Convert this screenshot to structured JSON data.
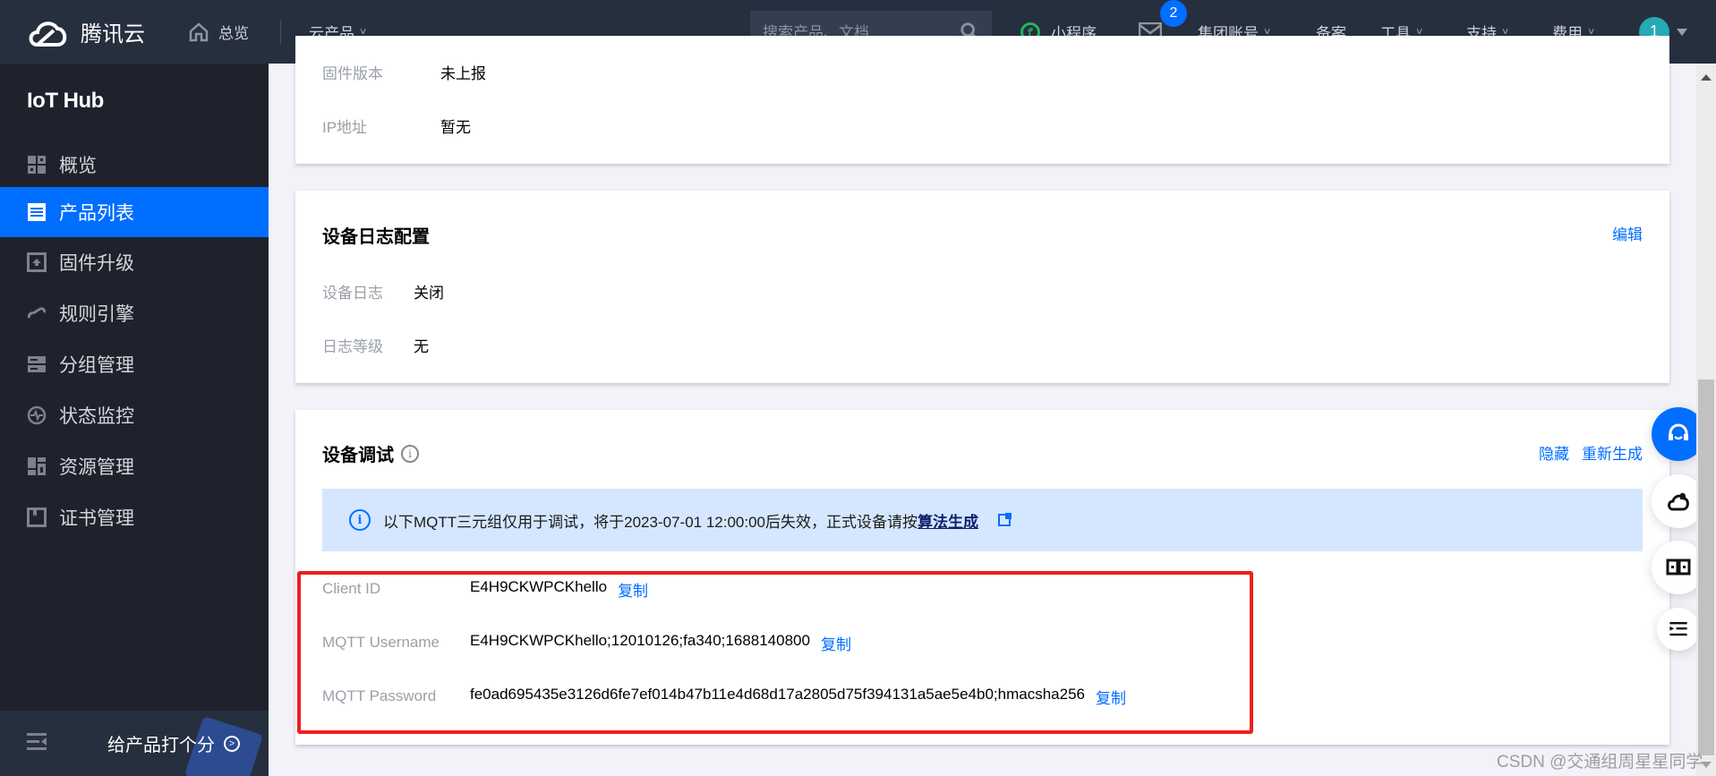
{
  "header": {
    "brand": "腾讯云",
    "home": "总览",
    "products": "云产品",
    "search_placeholder": "搜索产品、文档...",
    "mini_program": "小程序",
    "mail_badge": "2",
    "group_account": "集团账号",
    "beian": "备案",
    "tools": "工具",
    "support": "支持",
    "fees": "费用",
    "avatar": "1"
  },
  "sidebar": {
    "title": "IoT Hub",
    "items": [
      {
        "label": "概览",
        "icon": "grid-icon",
        "active": false
      },
      {
        "label": "产品列表",
        "icon": "list-icon",
        "active": true
      },
      {
        "label": "固件升级",
        "icon": "upload-icon",
        "active": false
      },
      {
        "label": "规则引擎",
        "icon": "link-icon",
        "active": false
      },
      {
        "label": "分组管理",
        "icon": "group-icon",
        "active": false
      },
      {
        "label": "状态监控",
        "icon": "monitor-icon",
        "active": false
      },
      {
        "label": "资源管理",
        "icon": "resource-icon",
        "active": false
      },
      {
        "label": "证书管理",
        "icon": "certificate-icon",
        "active": false
      }
    ],
    "rate_label": "给产品打个分"
  },
  "device_info": {
    "firmware_label": "固件版本",
    "firmware_value": "未上报",
    "ip_label": "IP地址",
    "ip_value": "暂无"
  },
  "log_config": {
    "title": "设备日志配置",
    "edit": "编辑",
    "log_label": "设备日志",
    "log_value": "关闭",
    "level_label": "日志等级",
    "level_value": "无"
  },
  "debug": {
    "title": "设备调试",
    "hide": "隐藏",
    "regenerate": "重新生成",
    "banner_text": "以下MQTT三元组仅用于调试，将于2023-07-01 12:00:00后失效，正式设备请按",
    "banner_link": "算法生成",
    "copy": "复制",
    "credentials": [
      {
        "label": "Client ID",
        "value": "E4H9CKWPCKhello"
      },
      {
        "label": "MQTT Username",
        "value": "E4H9CKWPCKhello;12010126;fa340;1688140800"
      },
      {
        "label": "MQTT Password",
        "value": "fe0ad695435e3126d6fe7ef014b47b11e4d68d17a2805d75f394131a5ae5e4b0;hmacsha256"
      }
    ]
  },
  "watermark": "CSDN @交通组周星星同学",
  "colors": {
    "accent": "#006eff",
    "header_bg": "#262f3e",
    "sidebar_bg": "#1f222c",
    "highlight_box": "#f21d1d",
    "banner_bg": "#d5e7ff"
  }
}
